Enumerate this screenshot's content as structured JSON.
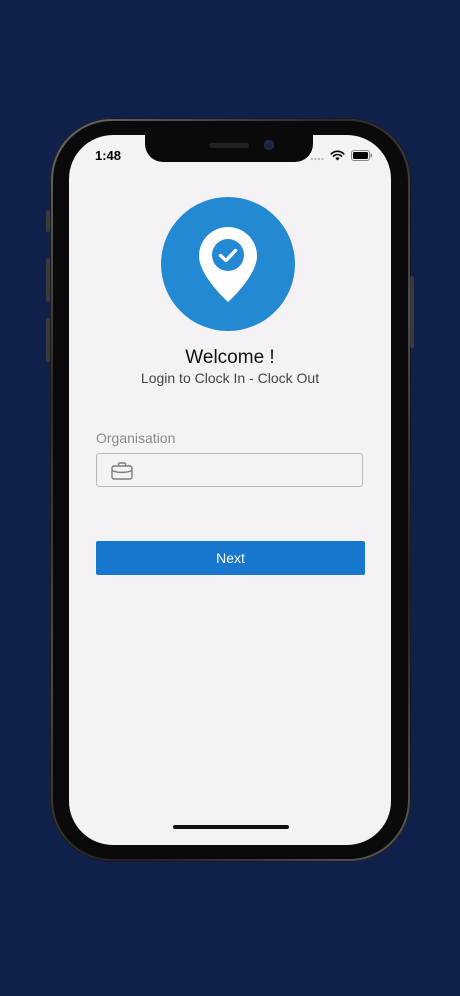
{
  "status_bar": {
    "time": "1:48",
    "icons": [
      "signal-dots-icon",
      "wifi-icon",
      "battery-icon"
    ]
  },
  "logo": {
    "icon": "location-pin-check-icon",
    "color": "#2389d3"
  },
  "header": {
    "title": "Welcome !",
    "subtitle": "Login to Clock In - Clock Out"
  },
  "form": {
    "organisation_label": "Organisation",
    "organisation_value": "",
    "organisation_icon": "briefcase-icon",
    "next_label": "Next"
  },
  "colors": {
    "background": "#0f214a",
    "accent": "#1878cf",
    "screen_bg": "#f5f2f6"
  }
}
